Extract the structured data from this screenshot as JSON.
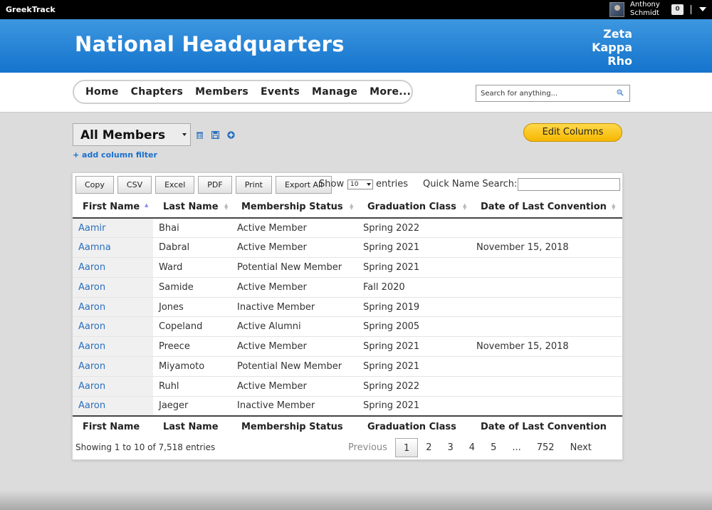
{
  "topbar": {
    "brand": "GreekTrack",
    "user_first": "Anthony",
    "user_last": "Schmidt",
    "notifications": "0",
    "separator": "|"
  },
  "header": {
    "title": "National Headquarters",
    "org_line1": "Zeta",
    "org_line2": "Kappa",
    "org_line3": "Rho"
  },
  "nav": {
    "items": [
      "Home",
      "Chapters",
      "Members",
      "Events",
      "Manage",
      "More..."
    ],
    "search_placeholder": "Search for anything..."
  },
  "controls": {
    "view": "All Members",
    "add_filter": "+ add column filter",
    "edit_columns": "Edit Columns"
  },
  "toolbar": {
    "buttons": [
      "Copy",
      "CSV",
      "Excel",
      "PDF",
      "Print",
      "Export All"
    ],
    "show": "Show",
    "page_size": "10",
    "entries": "entries",
    "quick_search": "Quick Name Search:"
  },
  "table": {
    "columns": [
      "First Name",
      "Last Name",
      "Membership Status",
      "Graduation Class",
      "Date of Last Convention"
    ],
    "rows": [
      [
        "Aamir",
        "Bhai",
        "Active Member",
        "Spring 2022",
        ""
      ],
      [
        "Aamna",
        "Dabral",
        "Active Member",
        "Spring 2021",
        "November 15, 2018"
      ],
      [
        "Aaron",
        "Ward",
        "Potential New Member",
        "Spring 2021",
        ""
      ],
      [
        "Aaron",
        "Samide",
        "Active Member",
        "Fall 2020",
        ""
      ],
      [
        "Aaron",
        "Jones",
        "Inactive Member",
        "Spring 2019",
        ""
      ],
      [
        "Aaron",
        "Copeland",
        "Active Alumni",
        "Spring 2005",
        ""
      ],
      [
        "Aaron",
        "Preece",
        "Active Member",
        "Spring 2021",
        "November 15, 2018"
      ],
      [
        "Aaron",
        "Miyamoto",
        "Potential New Member",
        "Spring 2021",
        ""
      ],
      [
        "Aaron",
        "Ruhl",
        "Active Member",
        "Spring 2022",
        ""
      ],
      [
        "Aaron",
        "Jaeger",
        "Inactive Member",
        "Spring 2021",
        ""
      ]
    ],
    "info": "Showing 1 to 10 of 7,518 entries"
  },
  "pager": {
    "previous": "Previous",
    "pages": [
      "1",
      "2",
      "3",
      "4",
      "5",
      "...",
      "752"
    ],
    "next": "Next",
    "current": "1"
  },
  "colors": {
    "header_blue": "#1f80d6",
    "link_blue": "#2a6ebd",
    "edit_button": "#f8c21c"
  }
}
